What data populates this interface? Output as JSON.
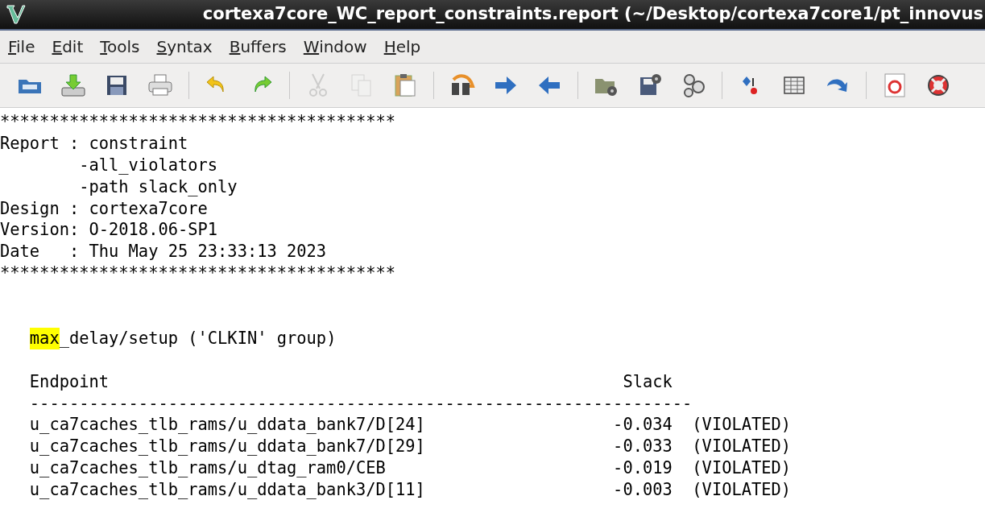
{
  "window": {
    "title": "cortexa7core_WC_report_constraints.report (~/Desktop/cortexa7core1/pt_innovus"
  },
  "menu": [
    "File",
    "Edit",
    "Tools",
    "Syntax",
    "Buffers",
    "Window",
    "Help"
  ],
  "toolbar": [
    [
      {
        "disabled": false
      },
      {
        "disabled": false
      },
      {
        "disabled": false
      },
      {
        "disabled": false
      }
    ],
    [
      {
        "disabled": false
      },
      {
        "disabled": false
      }
    ],
    [
      {
        "disabled": true
      },
      {
        "disabled": true
      },
      {
        "disabled": false
      }
    ],
    [
      {
        "disabled": false
      },
      {
        "disabled": false
      },
      {
        "disabled": false
      }
    ],
    [
      {
        "disabled": false
      },
      {
        "disabled": false
      },
      {
        "disabled": false
      }
    ],
    [
      {
        "disabled": false
      },
      {
        "disabled": false
      },
      {
        "disabled": false
      }
    ],
    [
      {
        "disabled": false
      },
      {
        "disabled": false
      }
    ]
  ],
  "buffer": [
    {
      "kind": "header",
      "lines": [
        "****************************************",
        "Report : constraint",
        "        -all_violators",
        "        -path slack_only",
        "Design : cortexa7core",
        "Version: O-2018.06-SP1",
        "Date   : Thu May 25 23:33:13 2023",
        "****************************************"
      ]
    },
    {
      "kind": "heading",
      "segments": [
        {
          "text": "max",
          "highlight": true
        },
        {
          "text": "_delay/setup ('CLKIN' group)",
          "highlight": false
        }
      ]
    },
    {
      "kind": "table",
      "lines": [
        "   Endpoint                                                    Slack",
        "   -------------------------------------------------------------------",
        "   u_ca7caches_tlb_rams/u_ddata_bank7/D[24]                   -0.034  (VIOLATED)",
        "   u_ca7caches_tlb_rams/u_ddata_bank7/D[29]                   -0.033  (VIOLATED)",
        "   u_ca7caches_tlb_rams/u_dtag_ram0/CEB                       -0.019  (VIOLATED)",
        "   u_ca7caches_tlb_rams/u_ddata_bank3/D[11]                   -0.003  (VIOLATED)"
      ]
    }
  ]
}
